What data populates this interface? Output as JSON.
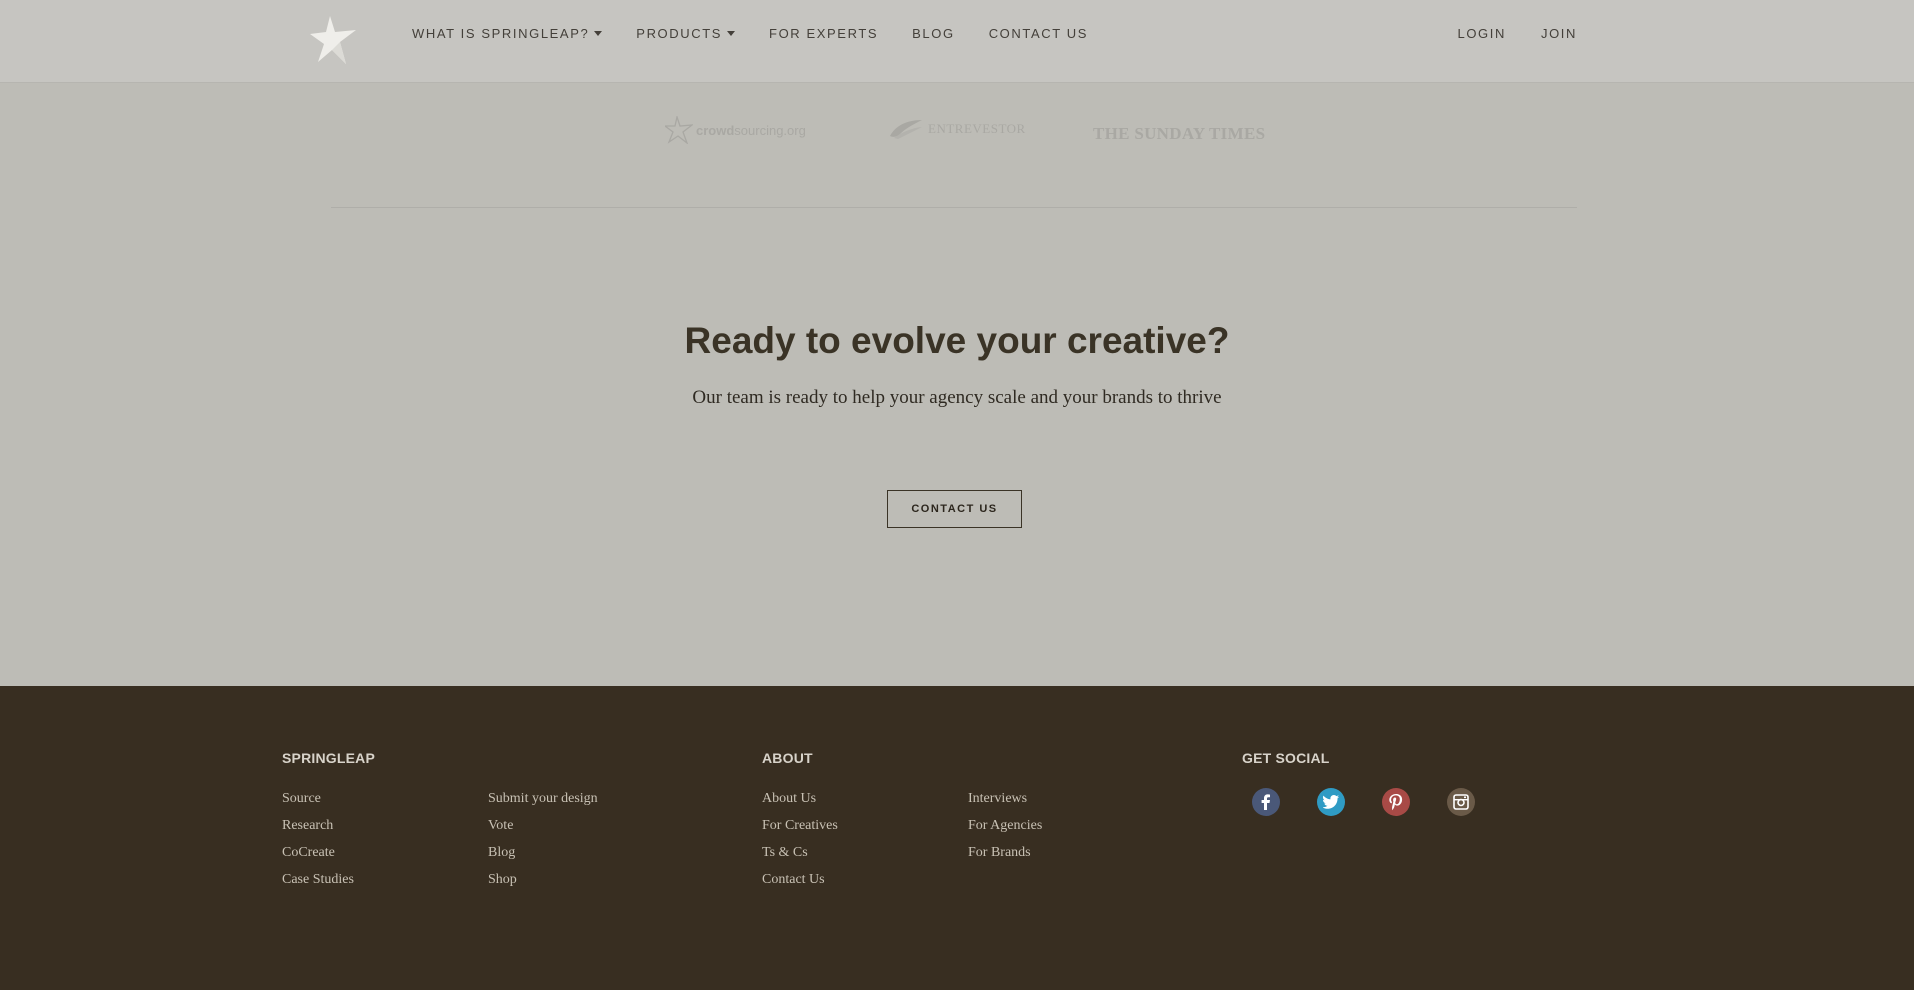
{
  "header": {
    "logo_icon": "springleap-star-icon",
    "nav": [
      {
        "label": "WHAT IS SPRINGLEAP?",
        "has_dropdown": true
      },
      {
        "label": "PRODUCTS",
        "has_dropdown": true
      },
      {
        "label": "FOR EXPERTS",
        "has_dropdown": false
      },
      {
        "label": "BLOG",
        "has_dropdown": false
      },
      {
        "label": "CONTACT US",
        "has_dropdown": false
      }
    ],
    "auth": {
      "login": "LOGIN",
      "join": "JOIN"
    }
  },
  "press": {
    "crowdsourcing": {
      "bold": "crowd",
      "rest": "sourcing.org"
    },
    "entrevestor": "ENTREVESTOR",
    "sunday_times": "THE SUNDAY TIMES"
  },
  "cta": {
    "title": "Ready to evolve your creative?",
    "subtitle": "Our team is ready to help your agency scale and your brands to thrive",
    "button": "CONTACT US"
  },
  "footer": {
    "springleap": {
      "heading": "SPRINGLEAP",
      "col1": [
        "Source",
        "Research",
        "CoCreate",
        "Case Studies"
      ],
      "col2": [
        "Submit your design",
        "Vote",
        "Blog",
        "Shop"
      ]
    },
    "about": {
      "heading": "ABOUT",
      "col1": [
        "About Us",
        "For Creatives",
        "Ts & Cs",
        "Contact Us"
      ],
      "col2": [
        "Interviews",
        "For Agencies",
        "For Brands"
      ]
    },
    "social": {
      "heading": "GET SOCIAL",
      "icons": [
        {
          "name": "facebook-icon",
          "color": "#4a5878",
          "glyph": "f"
        },
        {
          "name": "twitter-icon",
          "color": "#2f9bc4",
          "glyph": ""
        },
        {
          "name": "pinterest-icon",
          "color": "#a84a46",
          "glyph": "P"
        },
        {
          "name": "instagram-icon",
          "color": "#6a5a48",
          "glyph": ""
        }
      ]
    }
  },
  "colors": {
    "page_bg": "#bdbcb6",
    "header_bg": "#c6c5c1",
    "footer_bg": "#382e21",
    "heading_text": "#3a3326"
  }
}
